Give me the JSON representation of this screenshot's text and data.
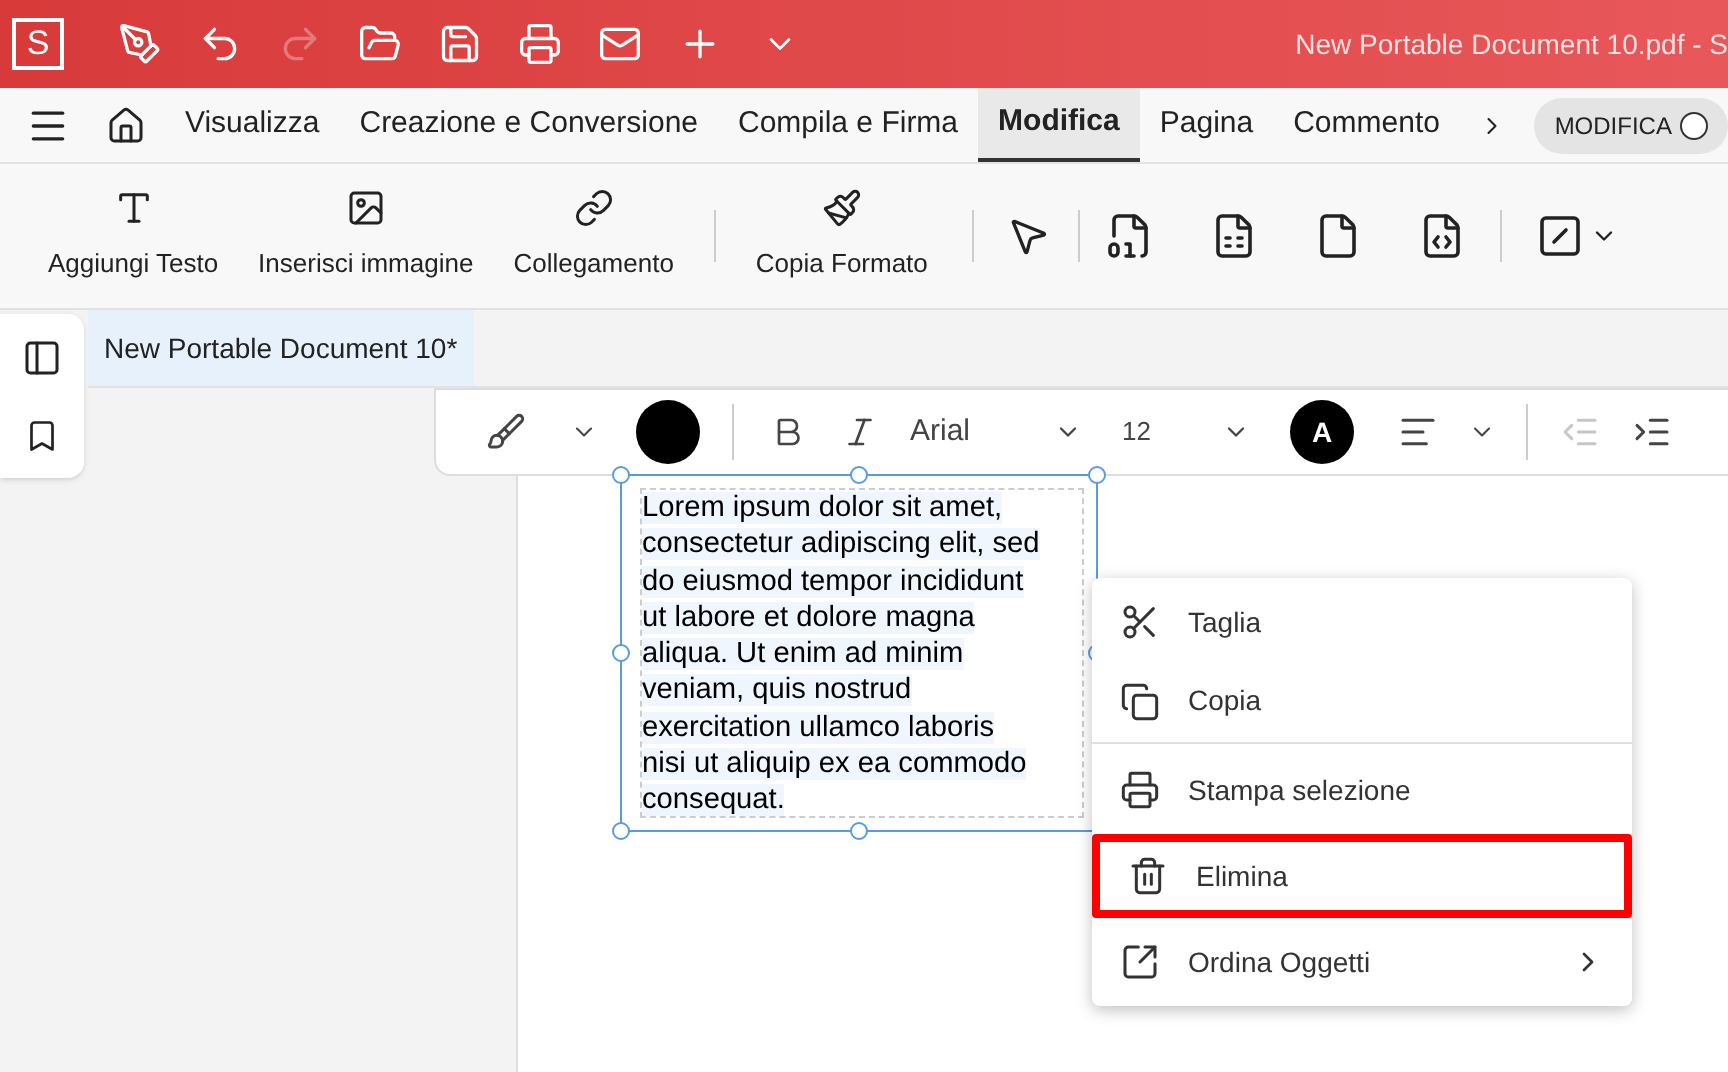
{
  "title_bar": {
    "logo": "S",
    "title": "New Portable Document 10.pdf  -  S",
    "tools": [
      {
        "kind": "pen",
        "disabled": false
      },
      {
        "kind": "undo",
        "disabled": false
      },
      {
        "kind": "redo",
        "disabled": true
      },
      {
        "kind": "open",
        "disabled": false
      },
      {
        "kind": "save",
        "disabled": false
      },
      {
        "kind": "print",
        "disabled": false
      },
      {
        "kind": "mail",
        "disabled": false
      },
      {
        "kind": "plus",
        "disabled": false
      },
      {
        "kind": "more",
        "disabled": false
      }
    ]
  },
  "tabs": [
    {
      "label": "Visualizza",
      "selected": false
    },
    {
      "label": "Creazione e Conversione",
      "selected": false
    },
    {
      "label": "Compila e Firma",
      "selected": false
    },
    {
      "label": "Modifica",
      "selected": true
    },
    {
      "label": "Pagina",
      "selected": false
    },
    {
      "label": "Commento",
      "selected": false
    }
  ],
  "mode_toggle": {
    "label": "MODIFICA",
    "on": false
  },
  "ribbon": [
    {
      "kind": "text",
      "label": "Aggiungi Testo"
    },
    {
      "kind": "image",
      "label": "Inserisci immagine"
    },
    {
      "kind": "link",
      "label": "Collegamento"
    },
    {
      "kind": "brush",
      "label": "Copia Formato"
    }
  ],
  "document_tab": {
    "label": "New Portable Document 10*"
  },
  "format_bar": {
    "font": "Arial",
    "size": "12",
    "font_color_letter": "A"
  },
  "text_box": {
    "lines": [
      "Lorem ipsum dolor sit amet,",
      "consectetur adipiscing elit, sed",
      "do eiusmod tempor incididunt",
      "ut labore et dolore magna",
      "aliqua. Ut enim ad minim",
      "veniam, quis nostrud",
      "exercitation ullamco laboris",
      "nisi ut aliquip ex ea commodo",
      "consequat."
    ]
  },
  "context_menu": [
    {
      "kind": "cut",
      "label": "Taglia",
      "highlighted": false,
      "divider_after": false
    },
    {
      "kind": "copy",
      "label": "Copia",
      "highlighted": false,
      "divider_after": true
    },
    {
      "kind": "print",
      "label": "Stampa selezione",
      "highlighted": false,
      "divider_after": false
    },
    {
      "kind": "delete",
      "label": "Elimina",
      "highlighted": true,
      "divider_after": false
    },
    {
      "kind": "arrange",
      "label": "Ordina Oggetti",
      "highlighted": false,
      "divider_after": false,
      "submenu": true
    }
  ]
}
